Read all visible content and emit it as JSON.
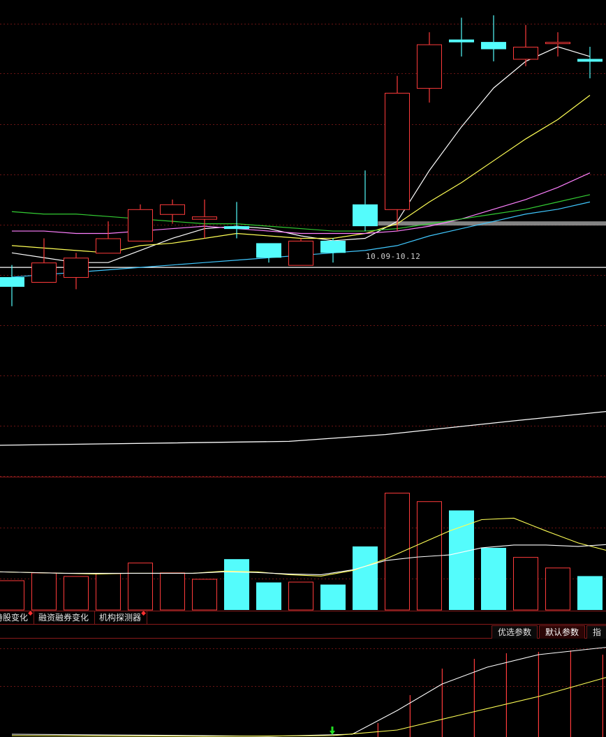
{
  "chart_data": {
    "type": "candlestick",
    "colors": {
      "up": "#ff3b3b",
      "down": "#54fcfc",
      "ma1": "#ffffff",
      "ma2": "#ffff55",
      "ma3": "#ff80ff",
      "ma4": "#33cc33",
      "ma5": "#40c8ff",
      "grid": "#6b1414",
      "volume_ma1": "#ffff55",
      "volume_ma2": "#ffffff"
    },
    "price_candles": [
      {
        "open": 10.42,
        "high": 10.47,
        "low": 10.3,
        "close": 10.38
      },
      {
        "open": 10.4,
        "high": 10.58,
        "low": 10.4,
        "close": 10.48
      },
      {
        "open": 10.42,
        "high": 10.52,
        "low": 10.37,
        "close": 10.5
      },
      {
        "open": 10.52,
        "high": 10.65,
        "low": 10.52,
        "close": 10.58
      },
      {
        "open": 10.57,
        "high": 10.72,
        "low": 10.57,
        "close": 10.7
      },
      {
        "open": 10.68,
        "high": 10.74,
        "low": 10.64,
        "close": 10.72
      },
      {
        "open": 10.66,
        "high": 10.74,
        "low": 10.58,
        "close": 10.67
      },
      {
        "open": 10.63,
        "high": 10.73,
        "low": 10.58,
        "close": 10.62
      },
      {
        "open": 10.56,
        "high": 10.56,
        "low": 10.48,
        "close": 10.5
      },
      {
        "open": 10.47,
        "high": 10.58,
        "low": 10.47,
        "close": 10.57
      },
      {
        "open": 10.57,
        "high": 10.58,
        "low": 10.48,
        "close": 10.52
      },
      {
        "open": 10.72,
        "high": 10.86,
        "low": 10.61,
        "close": 10.63
      },
      {
        "open": 10.7,
        "high": 11.25,
        "low": 10.61,
        "close": 11.18
      },
      {
        "open": 11.2,
        "high": 11.43,
        "low": 11.14,
        "close": 11.38
      },
      {
        "open": 11.4,
        "high": 11.49,
        "low": 11.33,
        "close": 11.39
      },
      {
        "open": 11.39,
        "high": 11.5,
        "low": 11.31,
        "close": 11.36
      },
      {
        "open": 11.32,
        "high": 11.46,
        "low": 11.29,
        "close": 11.37
      },
      {
        "open": 11.39,
        "high": 11.43,
        "low": 11.33,
        "close": 11.39
      },
      {
        "open": 11.32,
        "high": 11.37,
        "low": 11.24,
        "close": 11.31
      }
    ],
    "price_ylim": [
      10.21,
      11.54
    ],
    "ma_lines": [
      {
        "key": "ma1",
        "values": [
          10.52,
          10.5,
          10.48,
          10.48,
          10.53,
          10.58,
          10.62,
          10.63,
          10.62,
          10.59,
          10.57,
          10.58,
          10.65,
          10.86,
          11.04,
          11.2,
          11.31,
          11.37,
          11.33
        ]
      },
      {
        "key": "ma2",
        "values": [
          10.55,
          10.54,
          10.53,
          10.52,
          10.55,
          10.56,
          10.58,
          10.6,
          10.59,
          10.58,
          10.58,
          10.6,
          10.64,
          10.73,
          10.81,
          10.9,
          10.99,
          11.07,
          11.17
        ]
      },
      {
        "key": "ma3",
        "values": [
          10.61,
          10.61,
          10.6,
          10.6,
          10.61,
          10.62,
          10.63,
          10.62,
          10.61,
          10.6,
          10.6,
          10.6,
          10.61,
          10.63,
          10.66,
          10.7,
          10.74,
          10.79,
          10.85
        ]
      },
      {
        "key": "ma4",
        "values": [
          10.69,
          10.68,
          10.68,
          10.67,
          10.66,
          10.65,
          10.64,
          10.64,
          10.63,
          10.62,
          10.61,
          10.61,
          10.62,
          10.64,
          10.66,
          10.68,
          10.7,
          10.73,
          10.76
        ]
      },
      {
        "key": "ma5",
        "values": [
          10.42,
          10.43,
          10.44,
          10.45,
          10.46,
          10.47,
          10.48,
          10.49,
          10.5,
          10.51,
          10.52,
          10.53,
          10.55,
          10.59,
          10.62,
          10.65,
          10.68,
          10.7,
          10.73
        ]
      }
    ],
    "price_hline": 10.46,
    "range_band": {
      "from": 10.64,
      "to": 10.65,
      "label": "10.09-10.12",
      "start_index": 11.4
    },
    "indicator_line": [
      {
        "i": 0,
        "v": 0.3
      },
      {
        "i": 9,
        "v": 0.34
      },
      {
        "i": 12,
        "v": 0.41
      },
      {
        "i": 16,
        "v": 0.55
      },
      {
        "i": 19,
        "v": 0.65
      }
    ],
    "volume_bars": [
      {
        "v": 42,
        "dir": "up"
      },
      {
        "v": 53,
        "dir": "up"
      },
      {
        "v": 48,
        "dir": "up"
      },
      {
        "v": 52,
        "dir": "up"
      },
      {
        "v": 67,
        "dir": "up"
      },
      {
        "v": 53,
        "dir": "up"
      },
      {
        "v": 44,
        "dir": "up"
      },
      {
        "v": 72,
        "dir": "down"
      },
      {
        "v": 39,
        "dir": "down"
      },
      {
        "v": 40,
        "dir": "up"
      },
      {
        "v": 36,
        "dir": "down"
      },
      {
        "v": 90,
        "dir": "down"
      },
      {
        "v": 166,
        "dir": "up"
      },
      {
        "v": 154,
        "dir": "up"
      },
      {
        "v": 141,
        "dir": "down"
      },
      {
        "v": 88,
        "dir": "down"
      },
      {
        "v": 75,
        "dir": "up"
      },
      {
        "v": 60,
        "dir": "up"
      },
      {
        "v": 48,
        "dir": "down"
      }
    ],
    "volume_ylim": [
      0,
      172
    ],
    "volume_ma_lines": [
      {
        "key": "volume_ma1",
        "values": [
          54,
          53,
          52,
          51,
          52,
          52,
          52,
          55,
          54,
          50,
          48,
          56,
          72,
          92,
          112,
          128,
          130,
          112,
          95,
          83
        ]
      },
      {
        "key": "volume_ma2",
        "values": [
          54,
          53,
          52,
          52,
          52,
          52,
          52,
          54,
          53,
          51,
          50,
          57,
          70,
          75,
          78,
          88,
          92,
          92,
          90,
          93
        ]
      }
    ],
    "sub_candles": [
      {
        "i": 11.4,
        "h": 20
      },
      {
        "i": 12.4,
        "h": 60
      },
      {
        "i": 13.4,
        "h": 98
      },
      {
        "i": 14.4,
        "h": 112
      },
      {
        "i": 15.4,
        "h": 120
      },
      {
        "i": 16.4,
        "h": 122
      },
      {
        "i": 17.4,
        "h": 124
      },
      {
        "i": 18.4,
        "h": 118
      }
    ],
    "sub_lines": [
      {
        "key": "ma1",
        "values": [
          [
            0,
            4
          ],
          [
            6,
            2
          ],
          [
            8,
            1
          ],
          [
            10.6,
            4
          ],
          [
            12,
            38
          ],
          [
            13.4,
            76
          ],
          [
            14.8,
            100
          ],
          [
            16.4,
            118
          ],
          [
            18.4,
            128
          ],
          [
            19,
            131
          ]
        ]
      },
      {
        "key": "ma2",
        "values": [
          [
            0,
            2
          ],
          [
            6,
            1
          ],
          [
            10,
            2
          ],
          [
            12,
            10
          ],
          [
            14,
            32
          ],
          [
            16.4,
            58
          ],
          [
            18.4,
            84
          ],
          [
            19,
            92
          ]
        ]
      }
    ]
  },
  "tabs": [
    {
      "label": "持股变化"
    },
    {
      "label": "融资融券变化"
    },
    {
      "label": "机构探测器"
    }
  ],
  "param_tabs": {
    "preferred": "优选参数",
    "default": "默认参数",
    "indicator": "指"
  }
}
